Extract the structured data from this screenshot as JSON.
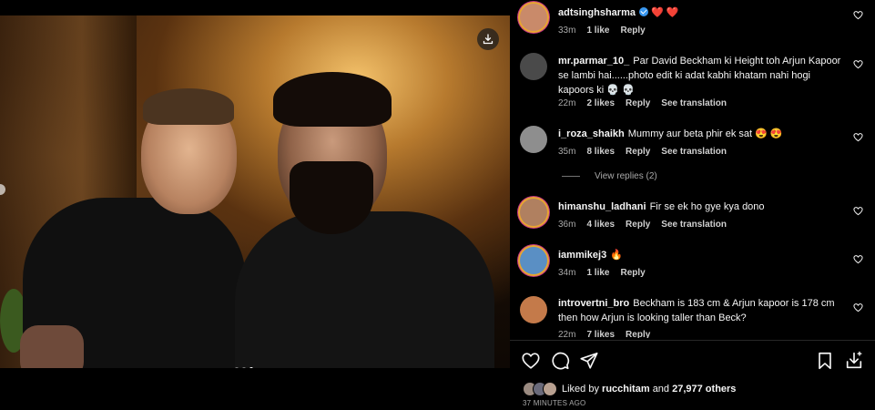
{
  "post": {
    "carousel_index": 3,
    "carousel_total": 3
  },
  "comments": [
    {
      "username": "adtsinghsharma",
      "verified": true,
      "text": "❤️ ❤️",
      "time": "33m",
      "likes": "1 like",
      "reply": "Reply",
      "see_translation": "",
      "avatar_color": "#c98a6a"
    },
    {
      "username": "mr.parmar_10_",
      "text": "Par David Beckham ki Height toh Arjun Kapoor se lambi hai......photo edit ki adat kabhi khatam nahi hogi kapoors ki 💀 💀",
      "time": "22m",
      "likes": "2 likes",
      "reply": "Reply",
      "see_translation": "See translation",
      "avatar_color": "#4a4a4a"
    },
    {
      "username": "i_roza_shaikh",
      "text": "Mummy aur beta phir ek sat 😍 😍",
      "time": "35m",
      "likes": "8 likes",
      "reply": "Reply",
      "see_translation": "See translation",
      "avatar_color": "#8e8e8e",
      "view_replies": "View replies (2)"
    },
    {
      "username": "himanshu_ladhani",
      "text": "Fir se ek ho gye kya dono",
      "time": "36m",
      "likes": "4 likes",
      "reply": "Reply",
      "see_translation": "See translation",
      "avatar_color": "#b08060"
    },
    {
      "username": "iammikej3",
      "text": "🔥",
      "time": "34m",
      "likes": "1 like",
      "reply": "Reply",
      "see_translation": "",
      "avatar_color": "#5a8fc4"
    },
    {
      "username": "introvertni_bro",
      "text": "Beckham is 183 cm & Arjun kapoor is 178 cm then how Arjun is looking taller than Beck?",
      "time": "22m",
      "likes": "7 likes",
      "reply": "Reply",
      "see_translation": "",
      "avatar_color": "#c47a4a"
    }
  ],
  "icons": {
    "like": "heart-outline-icon",
    "comment": "comment-icon",
    "share": "paper-plane-icon",
    "save": "bookmark-icon",
    "download": "download-icon"
  },
  "likes_summary": {
    "prefix": "Liked by",
    "user": "rucchitam",
    "and": "and",
    "others": "27,977 others"
  },
  "posted_ago": "37 MINUTES AGO"
}
